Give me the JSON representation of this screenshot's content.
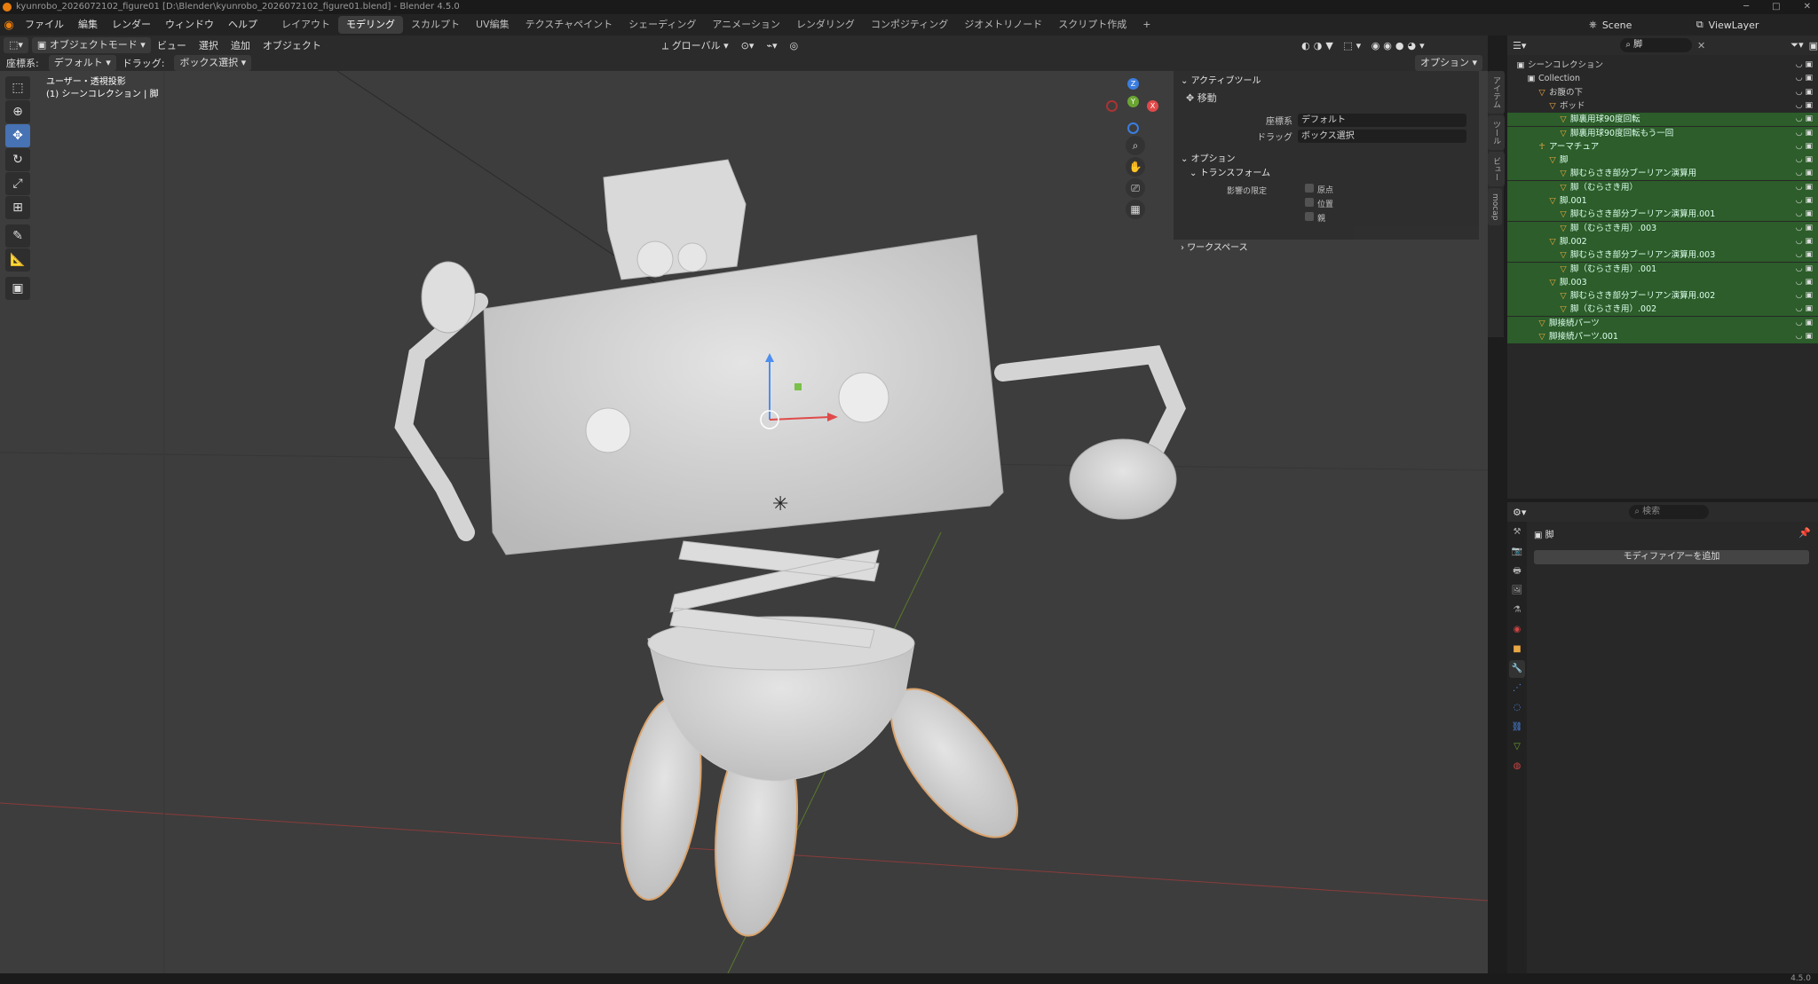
{
  "window": {
    "title": "kyunrobo_2026072102_figure01 [D:\\Blender\\kyunrobo_2026072102_figure01.blend] - Blender 4.5.0",
    "controls": [
      "─",
      "□",
      "✕"
    ]
  },
  "menu": [
    "ファイル",
    "編集",
    "レンダー",
    "ウィンドウ",
    "ヘルプ"
  ],
  "workspaces": [
    {
      "label": "レイアウト",
      "active": false
    },
    {
      "label": "モデリング",
      "active": true
    },
    {
      "label": "スカルプト",
      "active": false
    },
    {
      "label": "UV編集",
      "active": false
    },
    {
      "label": "テクスチャペイント",
      "active": false
    },
    {
      "label": "シェーディング",
      "active": false
    },
    {
      "label": "アニメーション",
      "active": false
    },
    {
      "label": "レンダリング",
      "active": false
    },
    {
      "label": "コンポジティング",
      "active": false
    },
    {
      "label": "ジオメトリノード",
      "active": false
    },
    {
      "label": "スクリプト作成",
      "active": false
    }
  ],
  "workspace_add": "+",
  "header3d": {
    "mode": "オブジェクトモード",
    "menus": [
      "ビュー",
      "選択",
      "追加",
      "オブジェクト"
    ],
    "orientation": "グローバル",
    "options": "オプション"
  },
  "toolheader": {
    "orient_label": "座標系:",
    "orient_value": "デフォルト",
    "drag_label": "ドラッグ:",
    "drag_value": "ボックス選択"
  },
  "viewport_info": {
    "line1": "ユーザー・透視投影",
    "line2": "(1) シーンコレクション | 脚"
  },
  "tools": [
    {
      "icon": "cursor-select-icon",
      "glyph": "⬚",
      "active": false
    },
    {
      "icon": "cursor-icon",
      "glyph": "⊕",
      "active": false
    },
    {
      "icon": "move-icon",
      "glyph": "✥",
      "active": true
    },
    {
      "icon": "rotate-icon",
      "glyph": "↻",
      "active": false
    },
    {
      "icon": "scale-icon",
      "glyph": "⤢",
      "active": false
    },
    {
      "icon": "transform-icon",
      "glyph": "⊞",
      "active": false
    },
    {
      "icon": "annotate-icon",
      "glyph": "✎",
      "active": false
    },
    {
      "icon": "measure-icon",
      "glyph": "📐",
      "active": false
    },
    {
      "icon": "add-cube-icon",
      "glyph": "▣",
      "active": false
    }
  ],
  "gizmo": {
    "z": "Z",
    "y": "Y",
    "x": "X"
  },
  "npanel": {
    "active_tool_header": "アクティブツール",
    "tool_name": "移動",
    "orient_label": "座標系",
    "orient_value": "デフォルト",
    "drag_label": "ドラッグ",
    "drag_value": "ボックス選択",
    "options_header": "オプション",
    "transform_header": "トランスフォーム",
    "affect_label": "影響の限定",
    "affect_items": [
      "原点",
      "位置",
      "親"
    ],
    "workspace_header": "ワークスペース"
  },
  "side_tabs": [
    "アイテム",
    "ツール",
    "ビュー",
    "mocap"
  ],
  "outliner": {
    "search": "脚",
    "scene": "Scene",
    "viewlayer": "ViewLayer",
    "items": [
      {
        "label": "シーンコレクション",
        "indent": 0,
        "sel": false,
        "icon": "collection-icon"
      },
      {
        "label": "Collection",
        "indent": 1,
        "sel": false,
        "icon": "collection-icon"
      },
      {
        "label": "お腹の下",
        "indent": 2,
        "sel": false,
        "icon": "mesh-icon"
      },
      {
        "label": "ボッド",
        "indent": 3,
        "sel": false,
        "icon": "mesh-icon"
      },
      {
        "label": "脚裏用球90度回転",
        "indent": 4,
        "sel": true,
        "icon": "mesh-icon"
      },
      {
        "label": "脚裏用球90度回転もう一回",
        "indent": 4,
        "sel": true,
        "icon": "mesh-icon"
      },
      {
        "label": "アーマチュア",
        "indent": 2,
        "sel": true,
        "icon": "armature-icon"
      },
      {
        "label": "脚",
        "indent": 3,
        "sel": true,
        "icon": "mesh-icon"
      },
      {
        "label": "脚むらさき部分ブーリアン演算用",
        "indent": 4,
        "sel": true,
        "icon": "mesh-icon"
      },
      {
        "label": "脚（むらさき用）",
        "indent": 4,
        "sel": true,
        "icon": "mesh-icon"
      },
      {
        "label": "脚.001",
        "indent": 3,
        "sel": true,
        "icon": "mesh-icon"
      },
      {
        "label": "脚むらさき部分ブーリアン演算用.001",
        "indent": 4,
        "sel": true,
        "icon": "mesh-icon"
      },
      {
        "label": "脚（むらさき用）.003",
        "indent": 4,
        "sel": true,
        "icon": "mesh-icon"
      },
      {
        "label": "脚.002",
        "indent": 3,
        "sel": true,
        "icon": "mesh-icon"
      },
      {
        "label": "脚むらさき部分ブーリアン演算用.003",
        "indent": 4,
        "sel": true,
        "icon": "mesh-icon"
      },
      {
        "label": "脚（むらさき用）.001",
        "indent": 4,
        "sel": true,
        "icon": "mesh-icon"
      },
      {
        "label": "脚.003",
        "indent": 3,
        "sel": true,
        "icon": "mesh-icon"
      },
      {
        "label": "脚むらさき部分ブーリアン演算用.002",
        "indent": 4,
        "sel": true,
        "icon": "mesh-icon"
      },
      {
        "label": "脚（むらさき用）.002",
        "indent": 4,
        "sel": true,
        "icon": "mesh-icon"
      },
      {
        "label": "脚接続パーツ",
        "indent": 2,
        "sel": true,
        "icon": "mesh-icon"
      },
      {
        "label": "脚接続パーツ.001",
        "indent": 2,
        "sel": true,
        "icon": "mesh-icon"
      }
    ]
  },
  "properties": {
    "search_placeholder": "検索",
    "object_name": "脚",
    "add_modifier": "モディファイアーを追加"
  },
  "status": {
    "version": "4.5.0"
  }
}
